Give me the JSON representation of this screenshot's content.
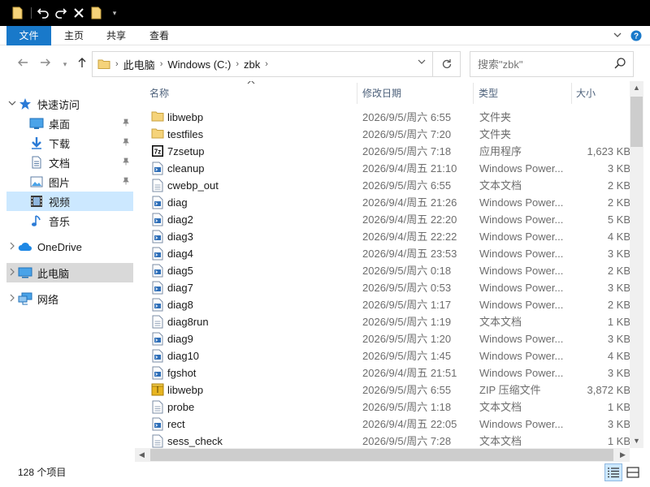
{
  "titlebar": {
    "icons": [
      "folder-icon",
      "undo-icon",
      "redo-icon",
      "delete-icon",
      "folder-icon",
      "customize-toolbar-icon"
    ]
  },
  "ribbon": {
    "tabs": [
      {
        "label": "文件",
        "active": true
      },
      {
        "label": "主页"
      },
      {
        "label": "共享"
      },
      {
        "label": "查看"
      }
    ]
  },
  "address": {
    "breadcrumbs": [
      "此电脑",
      "Windows (C:)",
      "zbk"
    ]
  },
  "search": {
    "placeholder": "搜索\"zbk\""
  },
  "nav": {
    "quick_access": "快速访问",
    "quick_items": [
      {
        "label": "桌面",
        "icon": "desktop-icon",
        "pinned": true
      },
      {
        "label": "下载",
        "icon": "download-icon",
        "pinned": true
      },
      {
        "label": "文档",
        "icon": "documents-icon",
        "pinned": true
      },
      {
        "label": "图片",
        "icon": "pictures-icon",
        "pinned": true
      },
      {
        "label": "视频",
        "icon": "videos-icon",
        "selected": true
      },
      {
        "label": "音乐",
        "icon": "music-icon"
      }
    ],
    "onedrive": "OneDrive",
    "this_pc": "此电脑",
    "network": "网络"
  },
  "columns": {
    "name": "名称",
    "date": "修改日期",
    "type": "类型",
    "size": "大小"
  },
  "files": [
    {
      "name": "libwebp",
      "date": "2026/9/5/周六 6:55",
      "type": "文件夹",
      "size": "",
      "icon": "folder-icon"
    },
    {
      "name": "testfiles",
      "date": "2026/9/5/周六 7:20",
      "type": "文件夹",
      "size": "",
      "icon": "folder-icon"
    },
    {
      "name": "7zsetup",
      "date": "2026/9/5/周六 7:18",
      "type": "应用程序",
      "size": "1,623 KB",
      "icon": "7zip-app-icon"
    },
    {
      "name": "cleanup",
      "date": "2026/9/4/周五 21:10",
      "type": "Windows Power...",
      "size": "3 KB",
      "icon": "powershell-script-icon"
    },
    {
      "name": "cwebp_out",
      "date": "2026/9/5/周六 6:55",
      "type": "文本文档",
      "size": "2 KB",
      "icon": "text-file-icon"
    },
    {
      "name": "diag",
      "date": "2026/9/4/周五 21:26",
      "type": "Windows Power...",
      "size": "2 KB",
      "icon": "powershell-script-icon"
    },
    {
      "name": "diag2",
      "date": "2026/9/4/周五 22:20",
      "type": "Windows Power...",
      "size": "5 KB",
      "icon": "powershell-script-icon"
    },
    {
      "name": "diag3",
      "date": "2026/9/4/周五 22:22",
      "type": "Windows Power...",
      "size": "4 KB",
      "icon": "powershell-script-icon"
    },
    {
      "name": "diag4",
      "date": "2026/9/4/周五 23:53",
      "type": "Windows Power...",
      "size": "3 KB",
      "icon": "powershell-script-icon"
    },
    {
      "name": "diag5",
      "date": "2026/9/5/周六 0:18",
      "type": "Windows Power...",
      "size": "2 KB",
      "icon": "powershell-script-icon"
    },
    {
      "name": "diag7",
      "date": "2026/9/5/周六 0:53",
      "type": "Windows Power...",
      "size": "3 KB",
      "icon": "powershell-script-icon"
    },
    {
      "name": "diag8",
      "date": "2026/9/5/周六 1:17",
      "type": "Windows Power...",
      "size": "2 KB",
      "icon": "powershell-script-icon"
    },
    {
      "name": "diag8run",
      "date": "2026/9/5/周六 1:19",
      "type": "文本文档",
      "size": "1 KB",
      "icon": "text-file-icon"
    },
    {
      "name": "diag9",
      "date": "2026/9/5/周六 1:20",
      "type": "Windows Power...",
      "size": "3 KB",
      "icon": "powershell-script-icon"
    },
    {
      "name": "diag10",
      "date": "2026/9/5/周六 1:45",
      "type": "Windows Power...",
      "size": "4 KB",
      "icon": "powershell-script-icon"
    },
    {
      "name": "fgshot",
      "date": "2026/9/4/周五 21:51",
      "type": "Windows Power...",
      "size": "3 KB",
      "icon": "powershell-script-icon"
    },
    {
      "name": "libwebp",
      "date": "2026/9/5/周六 6:55",
      "type": "ZIP 压缩文件",
      "size": "3,872 KB",
      "icon": "zip-archive-icon"
    },
    {
      "name": "probe",
      "date": "2026/9/5/周六 1:18",
      "type": "文本文档",
      "size": "1 KB",
      "icon": "text-file-icon"
    },
    {
      "name": "rect",
      "date": "2026/9/4/周五 22:05",
      "type": "Windows Power...",
      "size": "3 KB",
      "icon": "powershell-script-icon"
    },
    {
      "name": "sess_check",
      "date": "2026/9/5/周六 7:28",
      "type": "文本文档",
      "size": "1 KB",
      "icon": "text-file-icon"
    }
  ],
  "status": {
    "item_count": "128 个项目"
  },
  "colors": {
    "accent": "#1979ca",
    "selected_bg": "#cce8ff",
    "this_pc_bg": "#d9d9d9"
  }
}
